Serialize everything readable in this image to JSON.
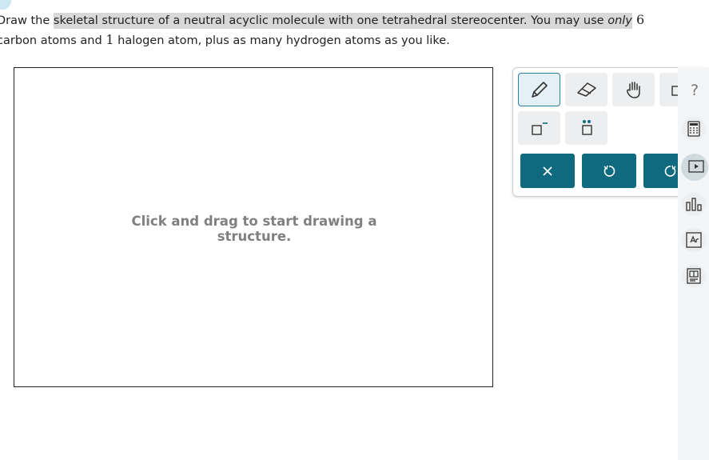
{
  "question": {
    "part1": "Draw the ",
    "part2_highlight": "skeletal structure of a neutral acyclic molecule with one tetrahedral stereocenter. You may use ",
    "part3_em": "only",
    "part4": " 6",
    "line2_a": "carbon atoms and ",
    "line2_num": "1",
    "line2_b": " halogen atom, plus as many hydrogen atoms as you like."
  },
  "canvas": {
    "hint_line1": "Click and drag to start drawing a",
    "hint_line2": "structure."
  },
  "toolbox": {
    "tools": [
      "pencil-icon",
      "eraser-icon",
      "hand-icon",
      "charge-plus-icon",
      "charge-minus-icon",
      "lone-pair-icon"
    ],
    "actions": [
      "clear",
      "undo",
      "redo"
    ],
    "help_label": "?"
  },
  "sidebar": {
    "icons": [
      "calculator-icon",
      "video-icon",
      "chart-icon",
      "periodic-table-icon",
      "reference-icon"
    ]
  },
  "colors": {
    "accent": "#0f6a80",
    "highlight": "#d8d8d8",
    "hint_text": "#808080"
  }
}
